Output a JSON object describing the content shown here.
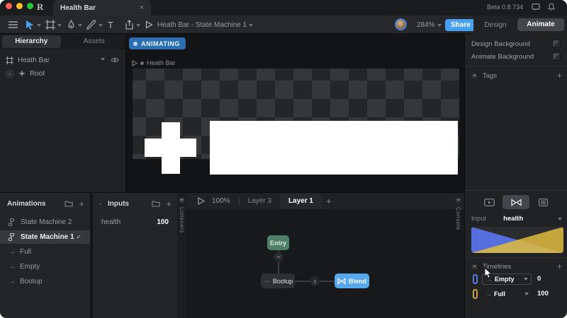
{
  "window": {
    "doc_tab": "Health Bar",
    "beta_label": "Beta 0.8.734"
  },
  "toolbar": {
    "breadcrumb": "Heath Bar - State Machine 1",
    "zoom_value": "284%",
    "share_label": "Share",
    "design_label": "Design",
    "animate_label": "Animate"
  },
  "left_panel": {
    "hierarchy_tab": "Hierarchy",
    "assets_tab": "Assets",
    "rows": [
      {
        "label": "Heath Bar"
      },
      {
        "label": "Root"
      }
    ]
  },
  "canvas": {
    "animating_badge": "ANIMATING",
    "artboard_label": "Heath Bar"
  },
  "animations": {
    "title": "Animations",
    "items": [
      {
        "label": "State Machine 2",
        "type": "state-machine",
        "selected": false
      },
      {
        "label": "State Machine 1",
        "type": "state-machine",
        "selected": true
      },
      {
        "label": "Full",
        "type": "timeline",
        "selected": false
      },
      {
        "label": "Empty",
        "type": "timeline",
        "selected": false
      },
      {
        "label": "Bootup",
        "type": "timeline",
        "selected": false
      }
    ]
  },
  "inputs": {
    "title": "Inputs",
    "rows": [
      {
        "name": "health",
        "value": "100"
      }
    ]
  },
  "side_tabs": {
    "listeners": "Listeners",
    "console": "Console"
  },
  "graph": {
    "zoom": "100%",
    "layer_tabs": [
      {
        "label": "Layer 3",
        "active": false
      },
      {
        "label": "Layer 1",
        "active": true
      }
    ],
    "entry_label": "Entry",
    "bootup_label": "Bootup",
    "blend_label": "Blend"
  },
  "right_panel": {
    "design_background": "Design Background",
    "animate_background": "Animate Background",
    "tags_title": "Tags",
    "input_label": "Input",
    "input_value": "health",
    "timelines_title": "Timelines",
    "timeline_rows": [
      {
        "label": "Empty",
        "value": "0",
        "color": "#5b78e8"
      },
      {
        "label": "Full",
        "value": "100",
        "color": "#cf9f3a"
      }
    ]
  },
  "colors": {
    "accent_blue": "#47a0f0",
    "animating_badge_blue": "#2b6fb2",
    "entry_node_green": "#4e7f68",
    "blend_node_blue": "#56a8ea",
    "blend_space_blue": "#5873e8",
    "blend_space_yellow": "#e0bc3e"
  }
}
